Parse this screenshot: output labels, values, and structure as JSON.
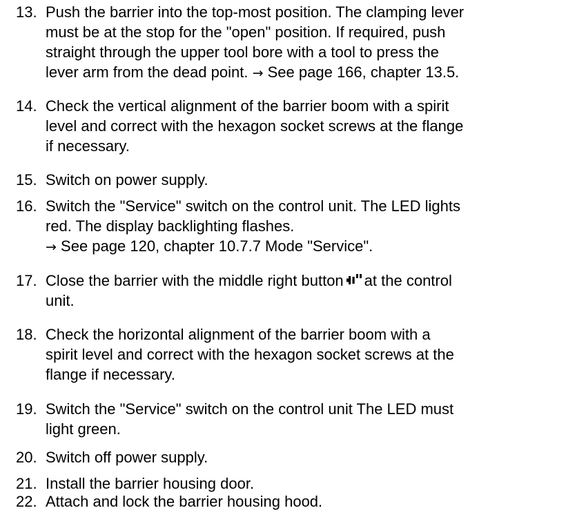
{
  "steps": [
    {
      "number": "13.",
      "lines": [
        "Push the barrier into the top-most position. The clamping lever",
        "must be at the stop for the \"open\" position. If required, push",
        "straight through the upper tool bore with a tool to press the"
      ],
      "ref_prefix": "lever arm from the dead point. ",
      "ref_arrow": "→",
      "ref_text": " See page 166, chapter 13.5."
    },
    {
      "number": "14.",
      "lines": [
        "Check the vertical alignment of the barrier boom with a spirit",
        "level and correct with the hexagon socket screws at the flange",
        "if necessary."
      ]
    },
    {
      "number": "15.",
      "lines": [
        "Switch on power supply."
      ]
    },
    {
      "number": "16.",
      "lines": [
        "Switch the \"Service\" switch on the control unit. The LED lights",
        "red. The display backlighting flashes."
      ],
      "ref_arrow": "→",
      "ref_text": " See page 120, chapter 10.7.7 Mode \"Service\"."
    },
    {
      "number": "17.",
      "line_before_icon": "Close the barrier with the middle right button",
      "icon": "close-barrier-button-icon",
      "line_after_icon": "at the control",
      "lines": [
        "unit."
      ]
    },
    {
      "number": "18.",
      "lines": [
        "Check the horizontal alignment of the barrier boom with a",
        "spirit level and correct with the hexagon socket screws at the",
        "flange if necessary."
      ]
    },
    {
      "number": "19.",
      "lines": [
        "Switch the \"Service\" switch on the control unit The LED must",
        "light green."
      ]
    },
    {
      "number": "20.",
      "lines": [
        "Switch off power supply."
      ]
    },
    {
      "number": "21.",
      "lines": [
        "Install the barrier housing door."
      ]
    },
    {
      "number": "22.",
      "lines": [
        "Attach and lock the barrier housing hood."
      ]
    }
  ]
}
